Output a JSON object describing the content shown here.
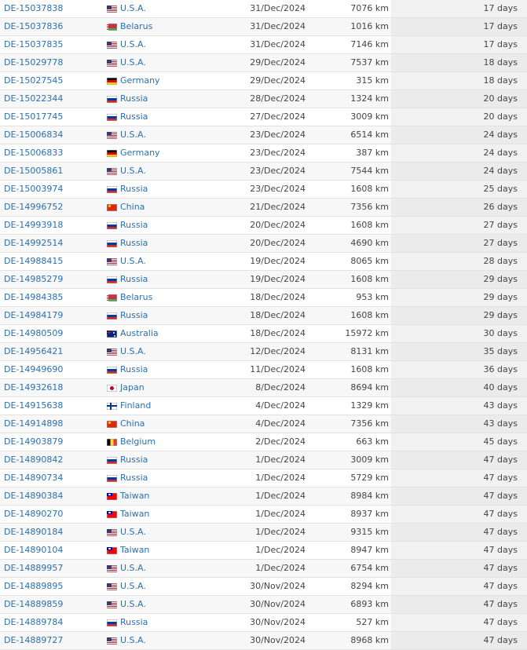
{
  "flags": {
    "U.S.A.": "usa-flag-icon",
    "Belarus": "belarus-flag-icon",
    "Germany": "germany-flag-icon",
    "Russia": "russia-flag-icon",
    "China": "china-flag-icon",
    "Australia": "australia-flag-icon",
    "Japan": "japan-flag-icon",
    "Finland": "finland-flag-icon",
    "Belgium": "belgium-flag-icon",
    "Taiwan": "taiwan-flag-icon"
  },
  "colors": {
    "link": "#2b6fae",
    "text": "#444444",
    "row_alt": "#f7f7f7",
    "days_bg": "#f1f1f1"
  },
  "rows": [
    {
      "id": "DE-15037838",
      "country": "U.S.A.",
      "date": "31/Dec/2024",
      "distance": "7076 km",
      "days": "17 days"
    },
    {
      "id": "DE-15037836",
      "country": "Belarus",
      "date": "31/Dec/2024",
      "distance": "1016 km",
      "days": "17 days"
    },
    {
      "id": "DE-15037835",
      "country": "U.S.A.",
      "date": "31/Dec/2024",
      "distance": "7146 km",
      "days": "17 days"
    },
    {
      "id": "DE-15029778",
      "country": "U.S.A.",
      "date": "29/Dec/2024",
      "distance": "7537 km",
      "days": "18 days"
    },
    {
      "id": "DE-15027545",
      "country": "Germany",
      "date": "29/Dec/2024",
      "distance": "315 km",
      "days": "18 days"
    },
    {
      "id": "DE-15022344",
      "country": "Russia",
      "date": "28/Dec/2024",
      "distance": "1324 km",
      "days": "20 days"
    },
    {
      "id": "DE-15017745",
      "country": "Russia",
      "date": "27/Dec/2024",
      "distance": "3009 km",
      "days": "20 days"
    },
    {
      "id": "DE-15006834",
      "country": "U.S.A.",
      "date": "23/Dec/2024",
      "distance": "6514 km",
      "days": "24 days"
    },
    {
      "id": "DE-15006833",
      "country": "Germany",
      "date": "23/Dec/2024",
      "distance": "387 km",
      "days": "24 days"
    },
    {
      "id": "DE-15005861",
      "country": "U.S.A.",
      "date": "23/Dec/2024",
      "distance": "7544 km",
      "days": "24 days"
    },
    {
      "id": "DE-15003974",
      "country": "Russia",
      "date": "23/Dec/2024",
      "distance": "1608 km",
      "days": "25 days"
    },
    {
      "id": "DE-14996752",
      "country": "China",
      "date": "21/Dec/2024",
      "distance": "7356 km",
      "days": "26 days"
    },
    {
      "id": "DE-14993918",
      "country": "Russia",
      "date": "20/Dec/2024",
      "distance": "1608 km",
      "days": "27 days"
    },
    {
      "id": "DE-14992514",
      "country": "Russia",
      "date": "20/Dec/2024",
      "distance": "4690 km",
      "days": "27 days"
    },
    {
      "id": "DE-14988415",
      "country": "U.S.A.",
      "date": "19/Dec/2024",
      "distance": "8065 km",
      "days": "28 days"
    },
    {
      "id": "DE-14985279",
      "country": "Russia",
      "date": "19/Dec/2024",
      "distance": "1608 km",
      "days": "29 days"
    },
    {
      "id": "DE-14984385",
      "country": "Belarus",
      "date": "18/Dec/2024",
      "distance": "953 km",
      "days": "29 days"
    },
    {
      "id": "DE-14984179",
      "country": "Russia",
      "date": "18/Dec/2024",
      "distance": "1608 km",
      "days": "29 days"
    },
    {
      "id": "DE-14980509",
      "country": "Australia",
      "date": "18/Dec/2024",
      "distance": "15972 km",
      "days": "30 days"
    },
    {
      "id": "DE-14956421",
      "country": "U.S.A.",
      "date": "12/Dec/2024",
      "distance": "8131 km",
      "days": "35 days"
    },
    {
      "id": "DE-14949690",
      "country": "Russia",
      "date": "11/Dec/2024",
      "distance": "1608 km",
      "days": "36 days"
    },
    {
      "id": "DE-14932618",
      "country": "Japan",
      "date": "8/Dec/2024",
      "distance": "8694 km",
      "days": "40 days"
    },
    {
      "id": "DE-14915638",
      "country": "Finland",
      "date": "4/Dec/2024",
      "distance": "1329 km",
      "days": "43 days"
    },
    {
      "id": "DE-14914898",
      "country": "China",
      "date": "4/Dec/2024",
      "distance": "7356 km",
      "days": "43 days"
    },
    {
      "id": "DE-14903879",
      "country": "Belgium",
      "date": "2/Dec/2024",
      "distance": "663 km",
      "days": "45 days"
    },
    {
      "id": "DE-14890842",
      "country": "Russia",
      "date": "1/Dec/2024",
      "distance": "3009 km",
      "days": "47 days"
    },
    {
      "id": "DE-14890734",
      "country": "Russia",
      "date": "1/Dec/2024",
      "distance": "5729 km",
      "days": "47 days"
    },
    {
      "id": "DE-14890384",
      "country": "Taiwan",
      "date": "1/Dec/2024",
      "distance": "8984 km",
      "days": "47 days"
    },
    {
      "id": "DE-14890270",
      "country": "Taiwan",
      "date": "1/Dec/2024",
      "distance": "8937 km",
      "days": "47 days"
    },
    {
      "id": "DE-14890184",
      "country": "U.S.A.",
      "date": "1/Dec/2024",
      "distance": "9315 km",
      "days": "47 days"
    },
    {
      "id": "DE-14890104",
      "country": "Taiwan",
      "date": "1/Dec/2024",
      "distance": "8947 km",
      "days": "47 days"
    },
    {
      "id": "DE-14889957",
      "country": "U.S.A.",
      "date": "1/Dec/2024",
      "distance": "6754 km",
      "days": "47 days"
    },
    {
      "id": "DE-14889895",
      "country": "U.S.A.",
      "date": "30/Nov/2024",
      "distance": "8294 km",
      "days": "47 days"
    },
    {
      "id": "DE-14889859",
      "country": "U.S.A.",
      "date": "30/Nov/2024",
      "distance": "6893 km",
      "days": "47 days"
    },
    {
      "id": "DE-14889784",
      "country": "Russia",
      "date": "30/Nov/2024",
      "distance": "527 km",
      "days": "47 days"
    },
    {
      "id": "DE-14889727",
      "country": "U.S.A.",
      "date": "30/Nov/2024",
      "distance": "8968 km",
      "days": "47 days"
    }
  ]
}
